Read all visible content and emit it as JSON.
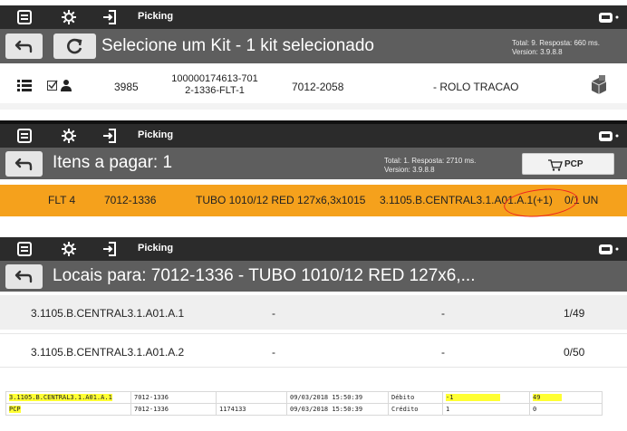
{
  "panel1": {
    "title": "Picking",
    "heading": "Selecione um Kit - 1 kit selecionado",
    "meta_line1": "Total: 9. Resposta: 660 ms.",
    "meta_line2": "Version: 3.9.8.8",
    "row": {
      "id": "3985",
      "code_line1": "100000174613-701",
      "code_line2": "2-1336-FLT-1",
      "part": "7012-2058",
      "desc": "- ROLO TRACAO"
    }
  },
  "panel2": {
    "title": "Picking",
    "heading": "Itens a pagar: 1",
    "meta_line1": "Total: 1. Resposta: 2710 ms.",
    "meta_line2": "Version: 3.9.8.8",
    "pcp_label": "PCP",
    "row": {
      "flt": "FLT 4",
      "part": "7012-1336",
      "desc": "TUBO 1010/12 RED 127x6,3x1015",
      "location": "3.1105.B.CENTRAL3.1.A01.A.1(+1)",
      "qty": "0/1 UN"
    }
  },
  "panel3": {
    "title": "Picking",
    "heading": "Locais para: 7012-1336 - TUBO 1010/12 RED 127x6,...",
    "rows": [
      {
        "location": "3.1105.B.CENTRAL3.1.A01.A.1",
        "col2": "-",
        "col3": "-",
        "qty": "1/49"
      },
      {
        "location": "3.1105.B.CENTRAL3.1.A01.A.2",
        "col2": "-",
        "col3": "-",
        "qty": "0/50"
      }
    ]
  },
  "grid": {
    "rows": [
      [
        "3.1105.B.CENTRAL3.1.A01.A.1",
        "7012-1336",
        "",
        "09/03/2018 15:50:39",
        "Débito",
        "-1",
        "49"
      ],
      [
        "PCP",
        "7012-1336",
        "1174133",
        "09/03/2018 15:50:39",
        "Crédito",
        "1",
        "0"
      ]
    ]
  },
  "colors": {
    "topbar": "#2b2b2b",
    "subbar": "#5e5e5e",
    "orange": "#f5a11c",
    "highlight": "#ffff33",
    "annotation": "#ee2222"
  }
}
